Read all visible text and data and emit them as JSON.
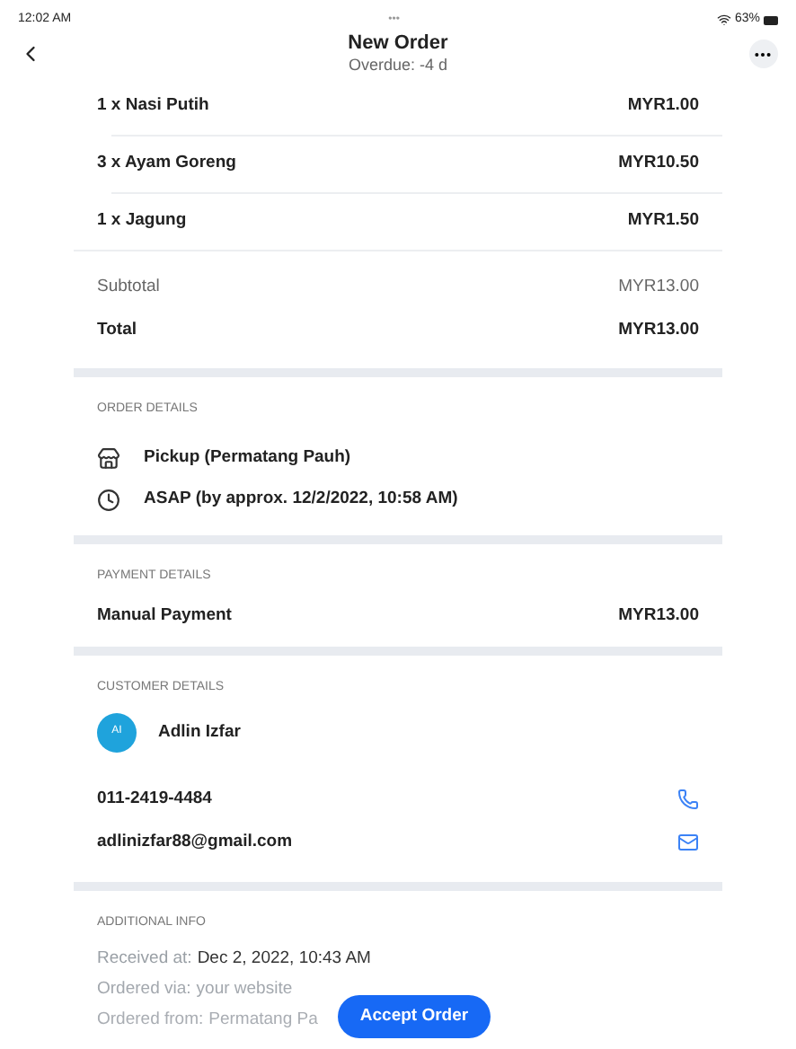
{
  "status_bar": {
    "time": "12:02 AM",
    "dots": "•••",
    "battery": "63%"
  },
  "header": {
    "title": "New Order",
    "subtitle": "Overdue: -4 d"
  },
  "items": [
    {
      "name": "1 x Nasi Putih",
      "price": "MYR1.00"
    },
    {
      "name": "3 x Ayam Goreng",
      "price": "MYR10.50"
    },
    {
      "name": "1 x Jagung",
      "price": "MYR1.50"
    }
  ],
  "subtotal": {
    "label": "Subtotal",
    "value": "MYR13.00"
  },
  "total": {
    "label": "Total",
    "value": "MYR13.00"
  },
  "order_details": {
    "heading": "ORDER DETAILS",
    "rows": [
      {
        "kind": "pickup",
        "text": "Pickup (Permatang Pauh)"
      },
      {
        "kind": "time",
        "text": "ASAP (by approx. 12/2/2022, 10:58 AM)"
      }
    ]
  },
  "payment_details": {
    "heading": "PAYMENT DETAILS",
    "method": "Manual Payment",
    "amount": "MYR13.00"
  },
  "customer_details": {
    "heading": "CUSTOMER DETAILS",
    "initials": "AI",
    "name": "Adlin Izfar",
    "contacts": [
      {
        "kind": "phone",
        "text": "011-2419-4484"
      },
      {
        "kind": "email",
        "text": "adlinizfar88@gmail.com"
      }
    ]
  },
  "additional_info": {
    "heading": "ADDITIONAL INFO",
    "lines": [
      {
        "label": "Received at:",
        "value": "Dec 2, 2022, 10:43 AM"
      },
      {
        "label": "Ordered via:",
        "value": "your website"
      },
      {
        "label": "Ordered from:",
        "value": "Permatang Pa"
      }
    ]
  },
  "accept_button": "Accept Order"
}
